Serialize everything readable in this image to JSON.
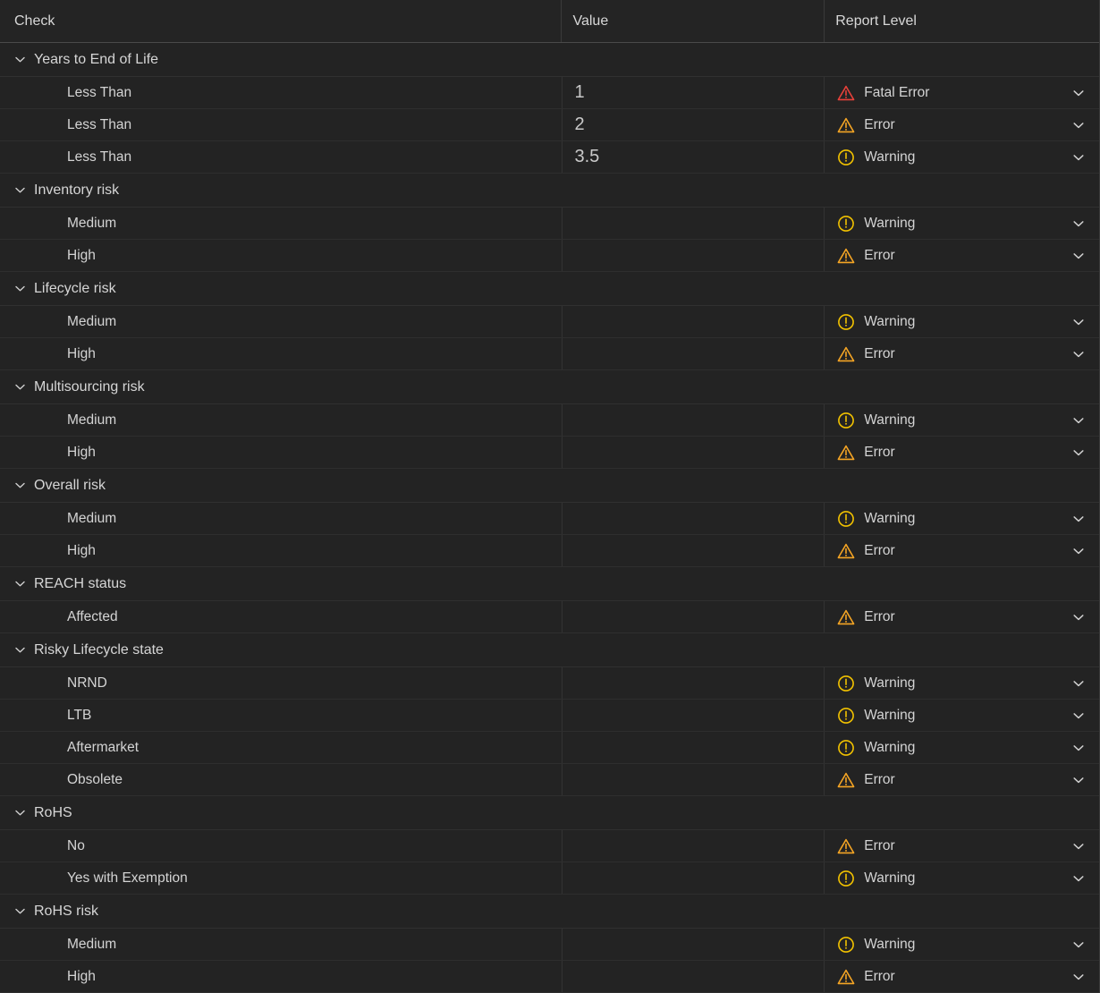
{
  "table": {
    "columns": [
      {
        "key": "check",
        "label": "Check"
      },
      {
        "key": "value",
        "label": "Value"
      },
      {
        "key": "report",
        "label": "Report Level"
      }
    ],
    "colors": {
      "fatal_error": "#e8413a",
      "error": "#f5a524",
      "warning": "#f2c200",
      "row_background": "#232323",
      "header_background": "#242424",
      "divider": "#333333",
      "text": "#d4d4d4"
    },
    "level_labels": {
      "fatal_error": "Fatal Error",
      "error": "Error",
      "warning": "Warning"
    },
    "groups": [
      {
        "label": "Years to End of Life",
        "expanded": true,
        "rows": [
          {
            "check": "Less Than",
            "value": "1",
            "level": "fatal_error",
            "level_label": "Fatal Error"
          },
          {
            "check": "Less Than",
            "value": "2",
            "level": "error",
            "level_label": "Error"
          },
          {
            "check": "Less Than",
            "value": "3.5",
            "level": "warning",
            "level_label": "Warning"
          }
        ]
      },
      {
        "label": "Inventory risk",
        "expanded": true,
        "rows": [
          {
            "check": "Medium",
            "value": "",
            "level": "warning",
            "level_label": "Warning"
          },
          {
            "check": "High",
            "value": "",
            "level": "error",
            "level_label": "Error"
          }
        ]
      },
      {
        "label": "Lifecycle risk",
        "expanded": true,
        "rows": [
          {
            "check": "Medium",
            "value": "",
            "level": "warning",
            "level_label": "Warning"
          },
          {
            "check": "High",
            "value": "",
            "level": "error",
            "level_label": "Error"
          }
        ]
      },
      {
        "label": "Multisourcing risk",
        "expanded": true,
        "rows": [
          {
            "check": "Medium",
            "value": "",
            "level": "warning",
            "level_label": "Warning"
          },
          {
            "check": "High",
            "value": "",
            "level": "error",
            "level_label": "Error"
          }
        ]
      },
      {
        "label": "Overall risk",
        "expanded": true,
        "rows": [
          {
            "check": "Medium",
            "value": "",
            "level": "warning",
            "level_label": "Warning"
          },
          {
            "check": "High",
            "value": "",
            "level": "error",
            "level_label": "Error"
          }
        ]
      },
      {
        "label": "REACH status",
        "expanded": true,
        "rows": [
          {
            "check": "Affected",
            "value": "",
            "level": "error",
            "level_label": "Error"
          }
        ]
      },
      {
        "label": "Risky Lifecycle state",
        "expanded": true,
        "rows": [
          {
            "check": "NRND",
            "value": "",
            "level": "warning",
            "level_label": "Warning"
          },
          {
            "check": "LTB",
            "value": "",
            "level": "warning",
            "level_label": "Warning"
          },
          {
            "check": "Aftermarket",
            "value": "",
            "level": "warning",
            "level_label": "Warning"
          },
          {
            "check": "Obsolete",
            "value": "",
            "level": "error",
            "level_label": "Error"
          }
        ]
      },
      {
        "label": "RoHS",
        "expanded": true,
        "rows": [
          {
            "check": "No",
            "value": "",
            "level": "error",
            "level_label": "Error"
          },
          {
            "check": "Yes with Exemption",
            "value": "",
            "level": "warning",
            "level_label": "Warning"
          }
        ]
      },
      {
        "label": "RoHS risk",
        "expanded": true,
        "rows": [
          {
            "check": "Medium",
            "value": "",
            "level": "warning",
            "level_label": "Warning"
          },
          {
            "check": "High",
            "value": "",
            "level": "error",
            "level_label": "Error"
          }
        ]
      }
    ]
  }
}
